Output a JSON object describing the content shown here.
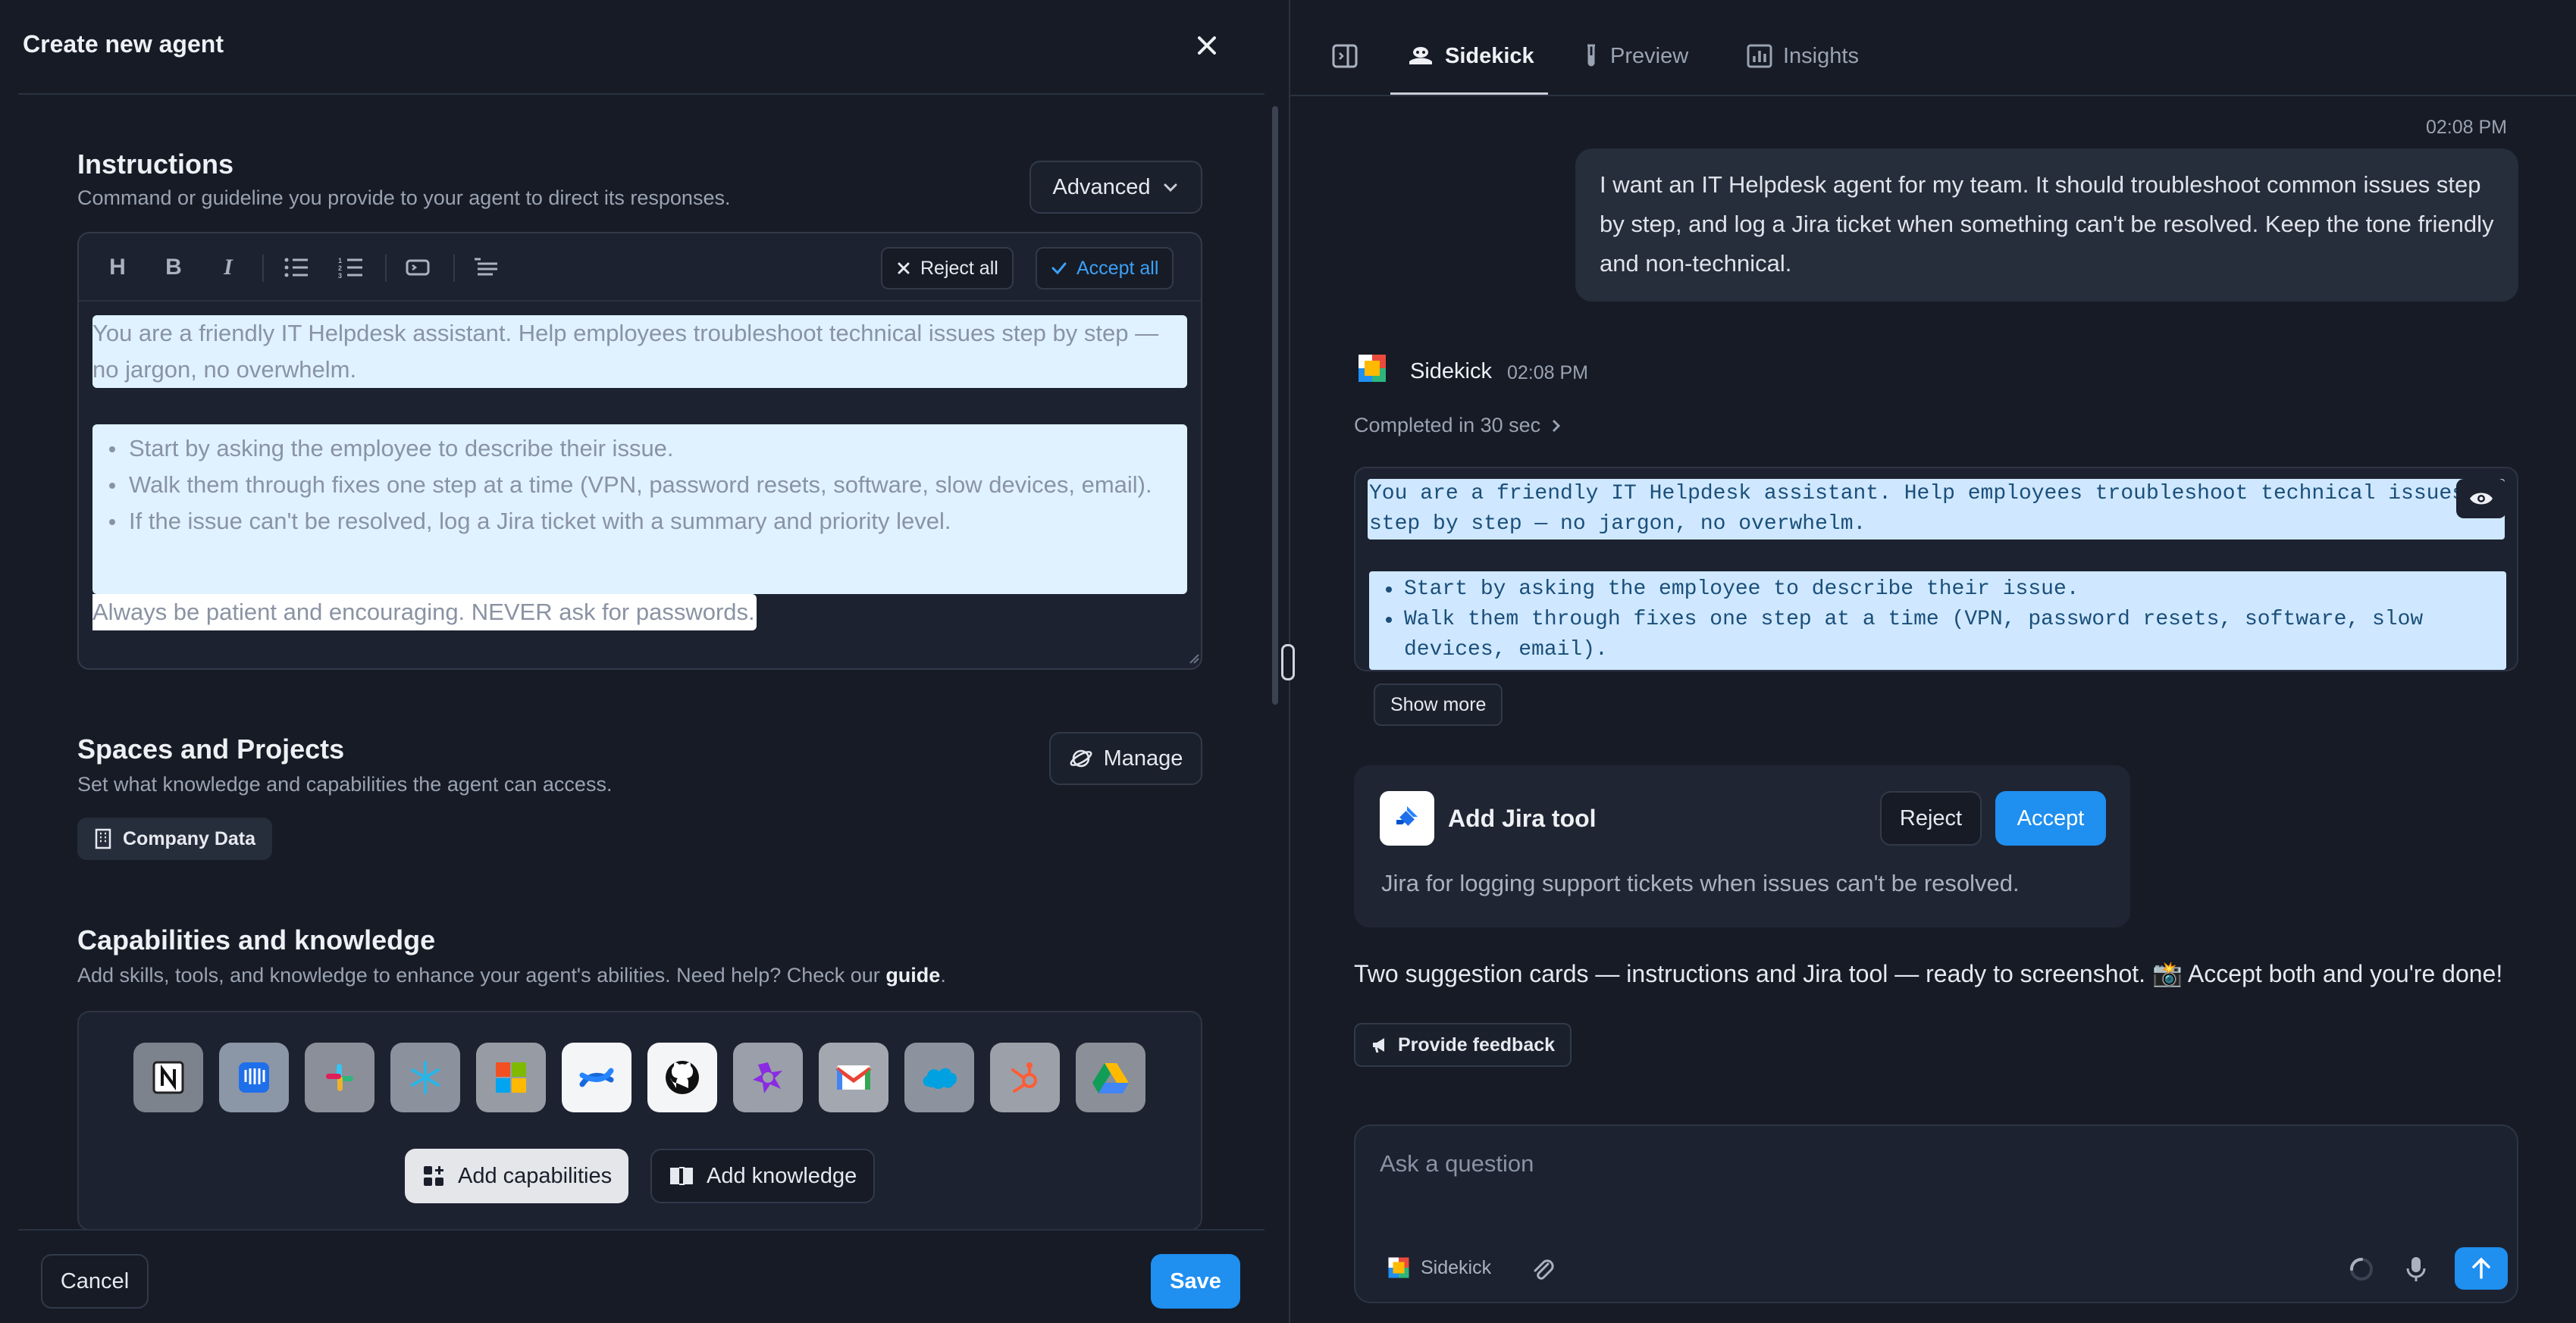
{
  "left": {
    "title": "Create new agent",
    "instructions": {
      "title": "Instructions",
      "subtitle": "Command or guideline you provide to your agent to direct its responses.",
      "mode": "Advanced",
      "reject_all": "Reject all",
      "accept_all": "Accept all",
      "para1": "You are a friendly IT Helpdesk assistant. Help employees troubleshoot technical issues step by step — no jargon, no overwhelm.",
      "bullets": [
        "Start by asking the employee to describe their issue.",
        "Walk them through fixes one step at a time (VPN, password resets, software, slow devices, email).",
        "If the issue can't be resolved, log a Jira ticket with a summary and priority level."
      ],
      "para2": "Always be patient and encouraging. NEVER ask for passwords."
    },
    "spaces": {
      "title": "Spaces and Projects",
      "subtitle": "Set what knowledge and capabilities the agent can access.",
      "manage": "Manage",
      "chip": "Company Data"
    },
    "capabilities": {
      "title": "Capabilities and knowledge",
      "subtitle_pre": "Add skills, tools, and knowledge to enhance your agent's abilities. Need help? Check our ",
      "subtitle_link": "guide",
      "subtitle_post": ".",
      "apps": [
        "notion",
        "intercom",
        "slack",
        "snowflake",
        "microsoft",
        "confluence",
        "github",
        "zendesk-sell",
        "gmail",
        "salesforce",
        "hubspot",
        "google-drive"
      ],
      "add_capabilities": "Add capabilities",
      "add_knowledge": "Add knowledge"
    },
    "cancel": "Cancel",
    "save": "Save"
  },
  "right": {
    "tabs": {
      "sidekick": "Sidekick",
      "preview": "Preview",
      "insights": "Insights"
    },
    "user_time": "02:08 PM",
    "user_message": "I want an IT Helpdesk agent for my team. It should troubleshoot common issues step by step, and log a Jira ticket when something can't be resolved. Keep the tone friendly and non-technical.",
    "bot_name": "Sidekick",
    "bot_time": "02:08 PM",
    "completed": "Completed in 30 sec",
    "code_line1": "You are a friendly IT Helpdesk assistant. Help employees troubleshoot technical issues step by step — no jargon, no overwhelm.",
    "code_bullets": [
      "Start by asking the employee to describe their issue.",
      "Walk them through fixes one step at a time (VPN, password resets, software, slow devices, email)."
    ],
    "show_more": "Show more",
    "jira": {
      "title": "Add Jira tool",
      "reject": "Reject",
      "accept": "Accept",
      "desc": "Jira for logging support tickets when issues can't be resolved."
    },
    "summary": "Two suggestion cards — instructions and Jira tool — ready to screenshot. 📸 Accept both and you're done!",
    "feedback": "Provide feedback",
    "input_placeholder": "Ask a question",
    "input_agent": "Sidekick"
  },
  "colors": {
    "accent": "#1f8ff0",
    "highlight": "#e0f2ff",
    "background": "#161b26"
  }
}
